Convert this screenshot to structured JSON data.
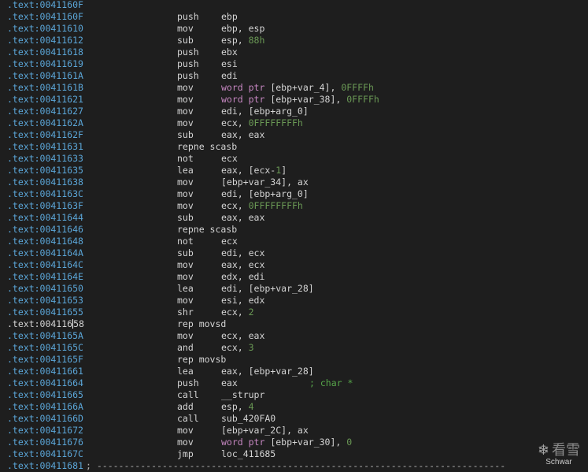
{
  "lines": [
    {
      "addr": ".text:0041160F",
      "mnemonic": "",
      "operands": []
    },
    {
      "addr": ".text:0041160F",
      "mnemonic": "push",
      "operands": [
        {
          "t": "ebp",
          "k": "plain"
        }
      ]
    },
    {
      "addr": ".text:00411610",
      "mnemonic": "mov",
      "operands": [
        {
          "t": "ebp, esp",
          "k": "plain"
        }
      ]
    },
    {
      "addr": ".text:00411612",
      "mnemonic": "sub",
      "operands": [
        {
          "t": "esp, ",
          "k": "plain"
        },
        {
          "t": "88h",
          "k": "num"
        }
      ]
    },
    {
      "addr": ".text:00411618",
      "mnemonic": "push",
      "operands": [
        {
          "t": "ebx",
          "k": "plain"
        }
      ]
    },
    {
      "addr": ".text:00411619",
      "mnemonic": "push",
      "operands": [
        {
          "t": "esi",
          "k": "plain"
        }
      ]
    },
    {
      "addr": ".text:0041161A",
      "mnemonic": "push",
      "operands": [
        {
          "t": "edi",
          "k": "plain"
        }
      ]
    },
    {
      "addr": ".text:0041161B",
      "mnemonic": "mov",
      "operands": [
        {
          "t": "word ptr",
          "k": "kw"
        },
        {
          "t": " [ebp+var_4], ",
          "k": "plain"
        },
        {
          "t": "0FFFFh",
          "k": "num"
        }
      ]
    },
    {
      "addr": ".text:00411621",
      "mnemonic": "mov",
      "operands": [
        {
          "t": "word ptr",
          "k": "kw"
        },
        {
          "t": " [ebp+var_38], ",
          "k": "plain"
        },
        {
          "t": "0FFFFh",
          "k": "num"
        }
      ]
    },
    {
      "addr": ".text:00411627",
      "mnemonic": "mov",
      "operands": [
        {
          "t": "edi, [ebp+arg_0]",
          "k": "plain"
        }
      ]
    },
    {
      "addr": ".text:0041162A",
      "mnemonic": "mov",
      "operands": [
        {
          "t": "ecx, ",
          "k": "plain"
        },
        {
          "t": "0FFFFFFFFh",
          "k": "num"
        }
      ]
    },
    {
      "addr": ".text:0041162F",
      "mnemonic": "sub",
      "operands": [
        {
          "t": "eax, eax",
          "k": "plain"
        }
      ]
    },
    {
      "addr": ".text:00411631",
      "mnemonic": "repne scasb",
      "operands": []
    },
    {
      "addr": ".text:00411633",
      "mnemonic": "not",
      "operands": [
        {
          "t": "ecx",
          "k": "plain"
        }
      ]
    },
    {
      "addr": ".text:00411635",
      "mnemonic": "lea",
      "operands": [
        {
          "t": "eax, [ecx-",
          "k": "plain"
        },
        {
          "t": "1",
          "k": "num"
        },
        {
          "t": "]",
          "k": "plain"
        }
      ]
    },
    {
      "addr": ".text:00411638",
      "mnemonic": "mov",
      "operands": [
        {
          "t": "[ebp+var_34], ax",
          "k": "plain"
        }
      ]
    },
    {
      "addr": ".text:0041163C",
      "mnemonic": "mov",
      "operands": [
        {
          "t": "edi, [ebp+arg_0]",
          "k": "plain"
        }
      ]
    },
    {
      "addr": ".text:0041163F",
      "mnemonic": "mov",
      "operands": [
        {
          "t": "ecx, ",
          "k": "plain"
        },
        {
          "t": "0FFFFFFFFh",
          "k": "num"
        }
      ]
    },
    {
      "addr": ".text:00411644",
      "mnemonic": "sub",
      "operands": [
        {
          "t": "eax, eax",
          "k": "plain"
        }
      ]
    },
    {
      "addr": ".text:00411646",
      "mnemonic": "repne scasb",
      "operands": []
    },
    {
      "addr": ".text:00411648",
      "mnemonic": "not",
      "operands": [
        {
          "t": "ecx",
          "k": "plain"
        }
      ]
    },
    {
      "addr": ".text:0041164A",
      "mnemonic": "sub",
      "operands": [
        {
          "t": "edi, ecx",
          "k": "plain"
        }
      ]
    },
    {
      "addr": ".text:0041164C",
      "mnemonic": "mov",
      "operands": [
        {
          "t": "eax, ecx",
          "k": "plain"
        }
      ]
    },
    {
      "addr": ".text:0041164E",
      "mnemonic": "mov",
      "operands": [
        {
          "t": "edx, edi",
          "k": "plain"
        }
      ]
    },
    {
      "addr": ".text:00411650",
      "mnemonic": "lea",
      "operands": [
        {
          "t": "edi, [ebp+var_28]",
          "k": "plain"
        }
      ]
    },
    {
      "addr": ".text:00411653",
      "mnemonic": "mov",
      "operands": [
        {
          "t": "esi, edx",
          "k": "plain"
        }
      ]
    },
    {
      "addr": ".text:00411655",
      "mnemonic": "shr",
      "operands": [
        {
          "t": "ecx, ",
          "k": "plain"
        },
        {
          "t": "2",
          "k": "num"
        }
      ]
    },
    {
      "addr": ".text:00411658",
      "mnemonic": "rep movsd",
      "operands": [],
      "current": true
    },
    {
      "addr": ".text:0041165A",
      "mnemonic": "mov",
      "operands": [
        {
          "t": "ecx, eax",
          "k": "plain"
        }
      ]
    },
    {
      "addr": ".text:0041165C",
      "mnemonic": "and",
      "operands": [
        {
          "t": "ecx, ",
          "k": "plain"
        },
        {
          "t": "3",
          "k": "num"
        }
      ]
    },
    {
      "addr": ".text:0041165F",
      "mnemonic": "rep movsb",
      "operands": []
    },
    {
      "addr": ".text:00411661",
      "mnemonic": "lea",
      "operands": [
        {
          "t": "eax, [ebp+var_28]",
          "k": "plain"
        }
      ]
    },
    {
      "addr": ".text:00411664",
      "mnemonic": "push",
      "operands": [
        {
          "t": "eax",
          "k": "plain"
        }
      ],
      "comment": "; char *"
    },
    {
      "addr": ".text:00411665",
      "mnemonic": "call",
      "operands": [
        {
          "t": "__strupr",
          "k": "plain"
        }
      ]
    },
    {
      "addr": ".text:0041166A",
      "mnemonic": "add",
      "operands": [
        {
          "t": "esp, ",
          "k": "plain"
        },
        {
          "t": "4",
          "k": "num"
        }
      ]
    },
    {
      "addr": ".text:0041166D",
      "mnemonic": "call",
      "operands": [
        {
          "t": "sub_420FA0",
          "k": "plain"
        }
      ]
    },
    {
      "addr": ".text:00411672",
      "mnemonic": "mov",
      "operands": [
        {
          "t": "[ebp+var_2C], ax",
          "k": "plain"
        }
      ]
    },
    {
      "addr": ".text:00411676",
      "mnemonic": "mov",
      "operands": [
        {
          "t": "word ptr",
          "k": "kw"
        },
        {
          "t": " [ebp+var_30], ",
          "k": "plain"
        },
        {
          "t": "0",
          "k": "num"
        }
      ]
    },
    {
      "addr": ".text:0041167C",
      "mnemonic": "jmp",
      "operands": [
        {
          "t": "loc_411685",
          "k": "plain"
        }
      ]
    },
    {
      "addr": ".text:00411681",
      "mnemonic": "",
      "operands": [],
      "separator": "; ---------------------------------------------------------------------------"
    }
  ],
  "watermark": {
    "logo_text": "看雪",
    "sub_text": "Schwar"
  },
  "colors": {
    "background": "#1e1e1e",
    "address": "#5ba6d8",
    "keyword": "#c586c0",
    "number": "#6a9955",
    "comment": "#57a64a",
    "text": "#d4d4d4"
  }
}
